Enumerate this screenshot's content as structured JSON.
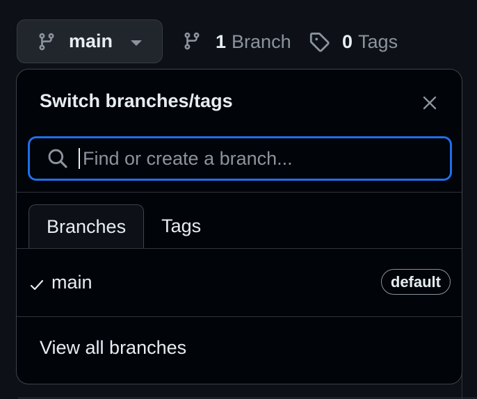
{
  "toolbar": {
    "branch_button": {
      "label": "main",
      "icon": "git-branch-icon",
      "caret_icon": "triangle-down-icon"
    },
    "branches_link": {
      "count": "1",
      "label": "Branch",
      "icon": "git-branch-icon"
    },
    "tags_link": {
      "count": "0",
      "label": "Tags",
      "icon": "tag-icon"
    }
  },
  "dropdown": {
    "title": "Switch branches/tags",
    "close_icon": "x-icon",
    "search": {
      "placeholder": "Find or create a branch...",
      "value": "",
      "icon": "search-icon"
    },
    "tabs": [
      {
        "label": "Branches",
        "active": true
      },
      {
        "label": "Tags",
        "active": false
      }
    ],
    "branches": [
      {
        "name": "main",
        "selected": true,
        "badge": "default",
        "check_icon": "check-icon"
      }
    ],
    "footer_link": "View all branches"
  },
  "colors": {
    "page_bg": "#0d1117",
    "panel_bg": "#010409",
    "focus_border": "#1f6feb",
    "text": "#e6edf3",
    "muted": "#8b949e",
    "border": "#30363d"
  }
}
